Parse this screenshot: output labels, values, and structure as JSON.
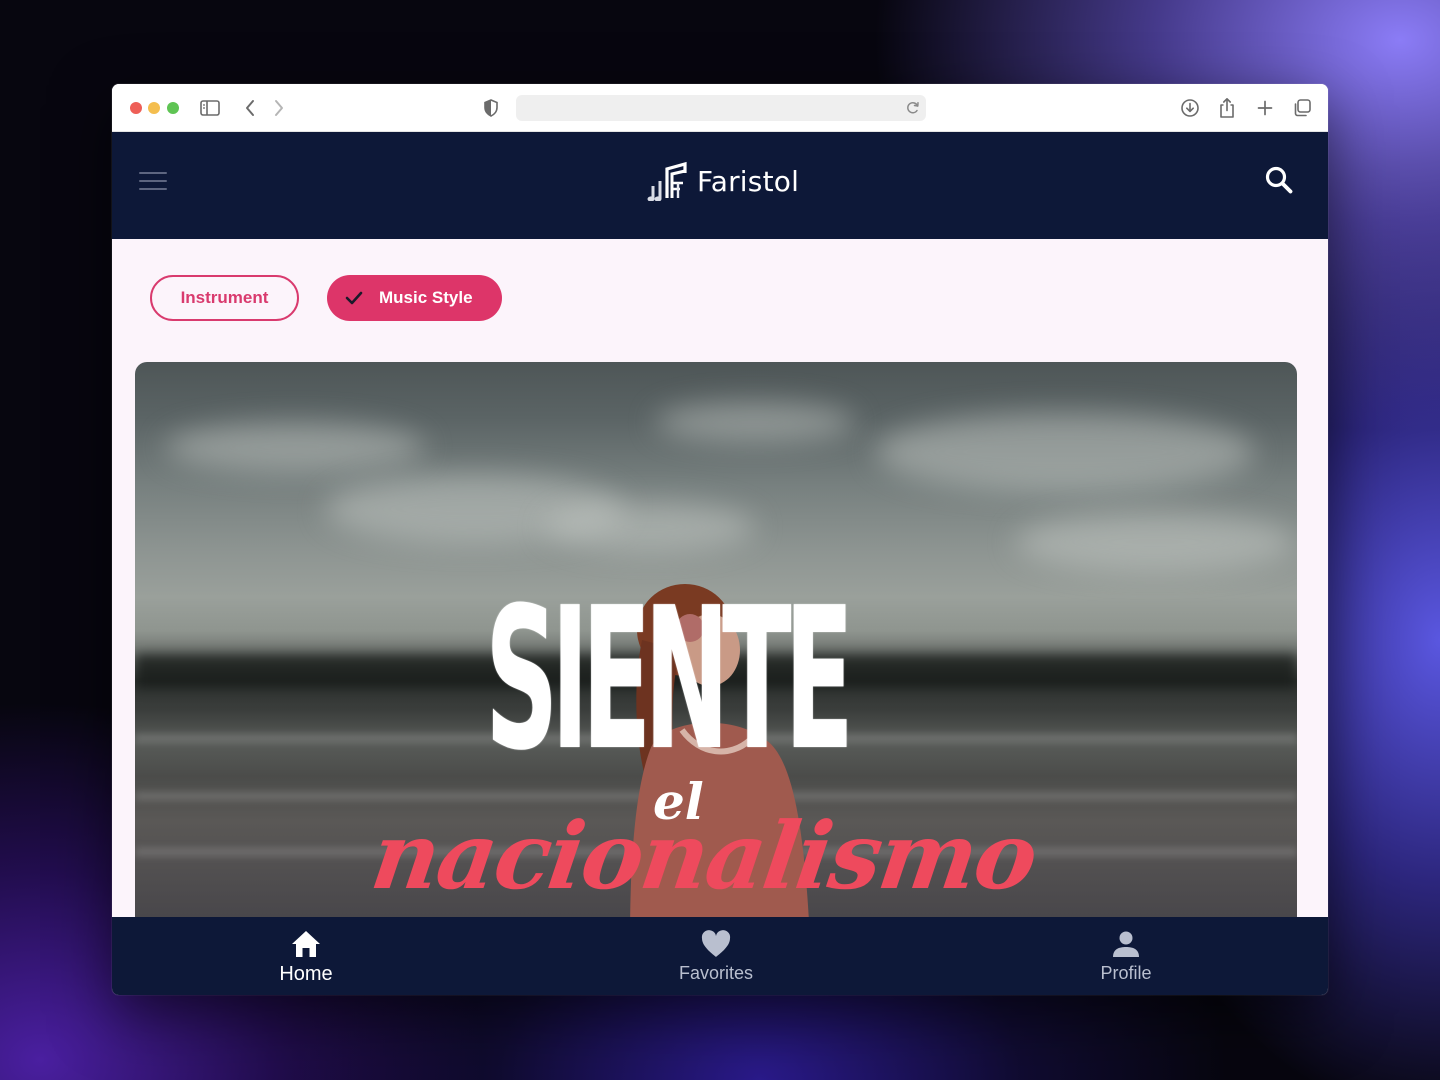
{
  "browser": {
    "address": "",
    "icons": [
      "sidebar-icon",
      "back-icon",
      "forward-icon",
      "shield-icon",
      "reload-icon",
      "download-icon",
      "share-icon",
      "new-tab-icon",
      "tabs-overview-icon"
    ]
  },
  "app": {
    "brand": "Faristol",
    "colors": {
      "header": "#0d1838",
      "accent": "#dd3569",
      "page": "#fcf4fb"
    }
  },
  "filters": [
    {
      "label": "Instrument",
      "selected": false
    },
    {
      "label": "Music Style",
      "selected": true
    }
  ],
  "hero": {
    "line1": "SIENTE",
    "line2": "el",
    "line3": "nacionalismo"
  },
  "bottom_nav": [
    {
      "label": "Home",
      "icon": "home-icon",
      "active": true
    },
    {
      "label": "Favorites",
      "icon": "heart-icon",
      "active": false
    },
    {
      "label": "Profile",
      "icon": "person-icon",
      "active": false
    }
  ]
}
